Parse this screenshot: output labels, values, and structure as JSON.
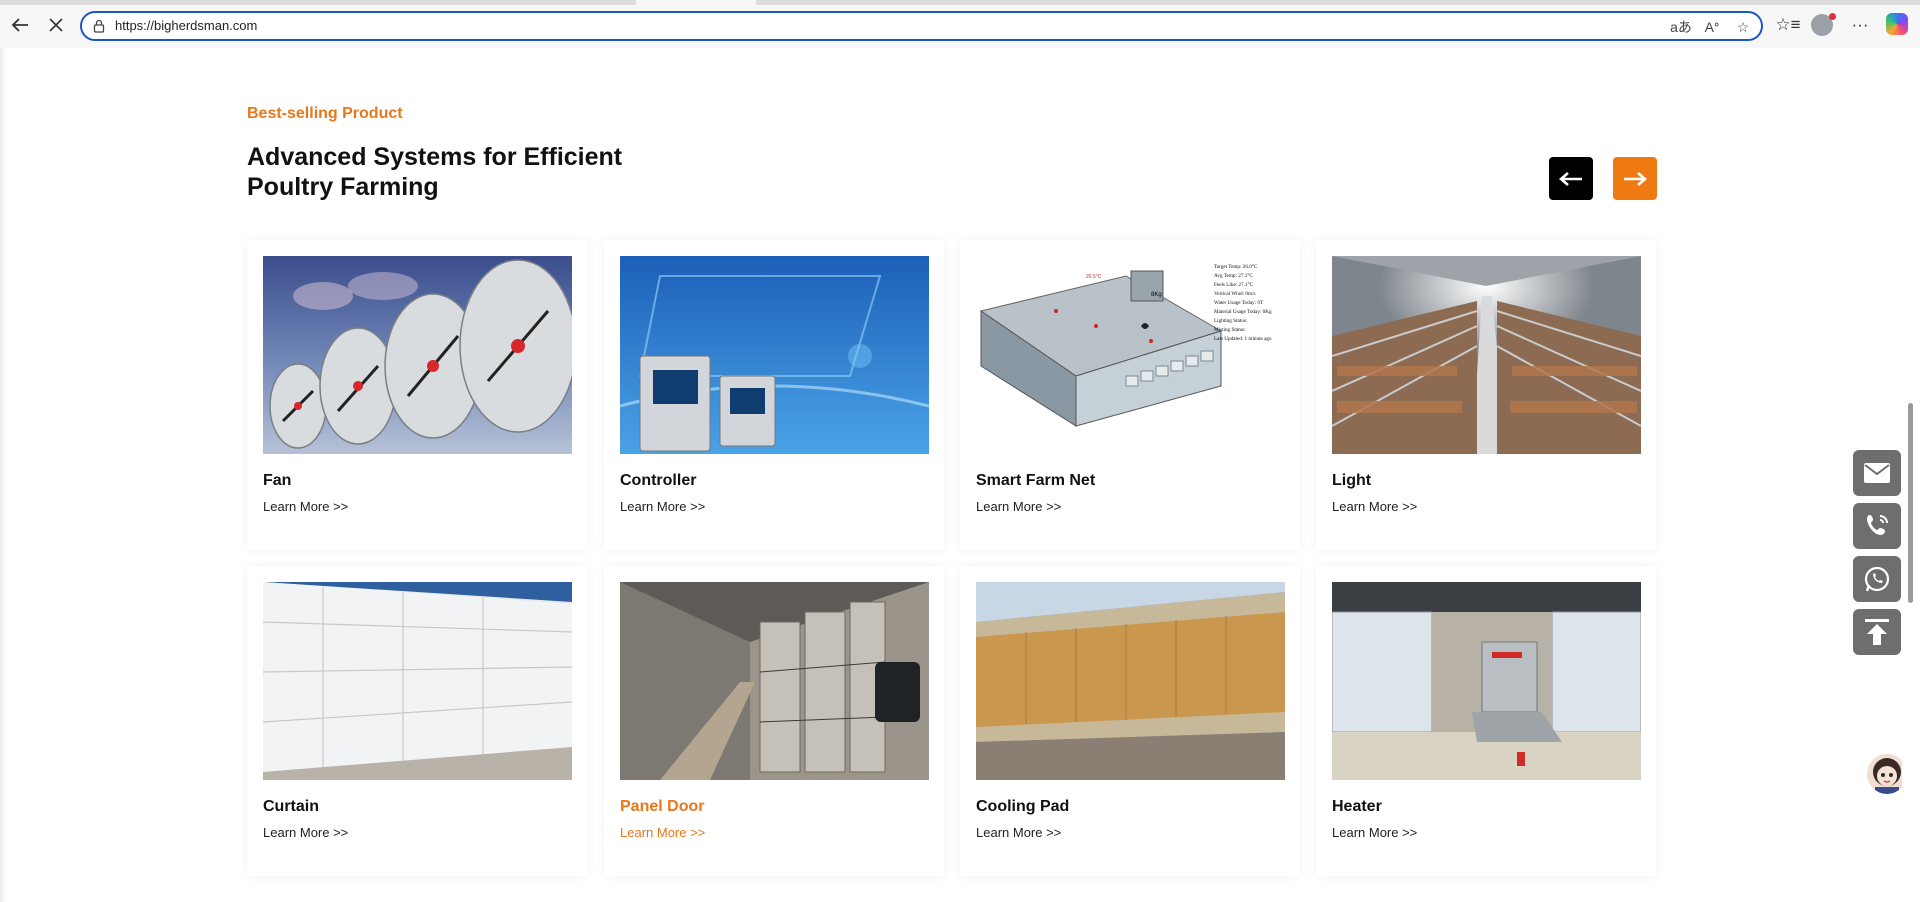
{
  "browser": {
    "url": "https://bigherdsman.com"
  },
  "section": {
    "eyebrow": "Best-selling Product",
    "heading": "Advanced Systems for Efficient Poultry Farming"
  },
  "carousel": {
    "prev_icon": "arrow-left-icon",
    "next_icon": "arrow-right-icon"
  },
  "products": [
    {
      "title": "Fan",
      "link": "Learn More >>"
    },
    {
      "title": "Controller",
      "link": "Learn More >>"
    },
    {
      "title": "Smart Farm Net",
      "link": "Learn More >>"
    },
    {
      "title": "Light",
      "link": "Learn More >>"
    },
    {
      "title": "Curtain",
      "link": "Learn More >>"
    },
    {
      "title": "Panel Door",
      "link": "Learn More >>"
    },
    {
      "title": "Cooling Pad",
      "link": "Learn More >>"
    },
    {
      "title": "Heater",
      "link": "Learn More >>"
    }
  ],
  "smart_farm_image_text": {
    "temp_1": "26.5°C",
    "weight": "8Kg",
    "stats": [
      "Target Temp: 26.0°C",
      "Avg Temp: 27.1°C",
      "Feels Like: 27.1°C",
      "Vertical Wind: 0m/s",
      "Water Usage Today: 0T",
      "Material Usage Today: 0Kg",
      "Lighting Status:",
      "Misting Status:",
      "Last Updated: 1 minute ago"
    ]
  },
  "colors": {
    "accent": "#e8771a",
    "dark": "#000000",
    "side_button": "#6e6e6e"
  },
  "side_actions": [
    "email-icon",
    "phone-icon",
    "whatsapp-icon",
    "back-to-top-icon"
  ]
}
